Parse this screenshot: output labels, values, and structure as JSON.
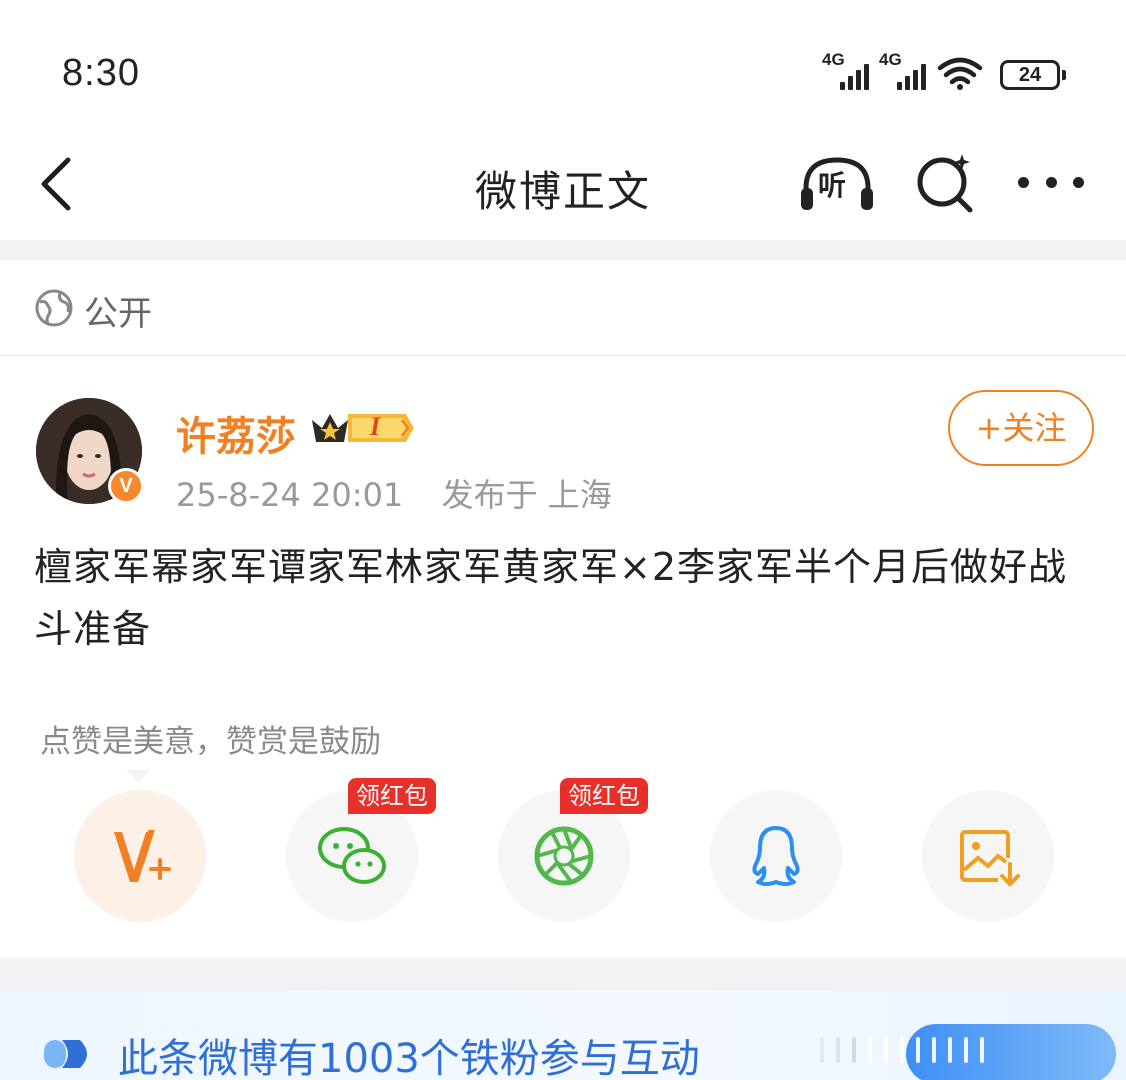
{
  "status_bar": {
    "time": "8:30",
    "signal1_label": "4G",
    "signal2_label": "4G",
    "battery": "24"
  },
  "navbar": {
    "title": "微博正文",
    "listen_label": "听"
  },
  "privacy": {
    "label": "公开"
  },
  "post": {
    "author": "许荔莎",
    "verified_badge": "V",
    "member_level": "I",
    "timestamp": "25-8-24 20:01",
    "location": "发布于 上海",
    "follow_label": "+关注",
    "text": "檀家军幂家军谭家军林家军黄家军×2李家军半个月后做好战斗准备"
  },
  "reward": {
    "tip": "点赞是美意，赞赏是鼓励"
  },
  "share": {
    "items": [
      {
        "name": "vplus",
        "icon": "v-plus-icon",
        "badge": ""
      },
      {
        "name": "wechat",
        "icon": "wechat-icon",
        "badge": "领红包"
      },
      {
        "name": "moments",
        "icon": "moments-icon",
        "badge": "领红包"
      },
      {
        "name": "qq",
        "icon": "qq-icon",
        "badge": ""
      },
      {
        "name": "save-image",
        "icon": "save-image-icon",
        "badge": ""
      }
    ]
  },
  "fans": {
    "text": "此条微博有1003个铁粉参与互动"
  },
  "colors": {
    "accent": "#f08024",
    "link_blue": "#2f6fd6",
    "red_badge": "#e8302a",
    "wechat_green": "#3cb034",
    "qq_blue": "#2a8ff0"
  }
}
